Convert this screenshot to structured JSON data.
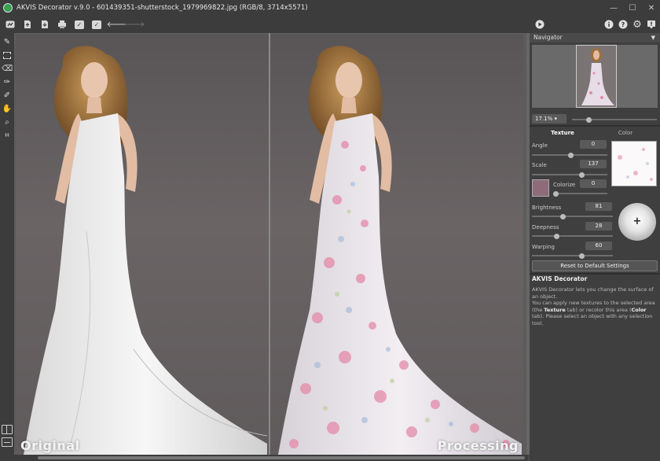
{
  "window": {
    "title": "AKVIS Decorator v.9.0 - 601439351-shutterstock_1979969822.jpg (RGB/8, 3714x5571)",
    "minimize_glyph": "—",
    "maximize_glyph": "☐",
    "close_glyph": "✕"
  },
  "toolbar": {
    "left_icons": [
      "home-icon",
      "open-file-icon",
      "save-file-icon",
      "print-icon",
      "batch-icon",
      "preset-icon",
      "undo-icon",
      "redo-icon"
    ],
    "right_icons": [
      "run-icon",
      "info-icon",
      "help-icon",
      "settings-icon",
      "notifications-icon"
    ]
  },
  "left_tools": [
    "selection-brush-icon",
    "rect-selection-icon",
    "eraser-icon",
    "bucket-icon",
    "magic-brush-icon",
    "hand-icon",
    "zoom-icon",
    "crop-icon"
  ],
  "canvas": {
    "left_label": "Original",
    "right_label": "Processing"
  },
  "navigator": {
    "title": "Navigator",
    "zoom": "17.1%"
  },
  "tabs": {
    "texture": "Texture",
    "color": "Color",
    "active": "Texture"
  },
  "params": {
    "angle": {
      "label": "Angle",
      "value": "0"
    },
    "scale": {
      "label": "Scale",
      "value": "137"
    },
    "colorize": {
      "label": "Colorize",
      "value": "0"
    },
    "brightness": {
      "label": "Brightness",
      "value": "81"
    },
    "deepness": {
      "label": "Deepness",
      "value": "28"
    },
    "warping": {
      "label": "Warping",
      "value": "60"
    }
  },
  "colorize_color": "#8f6b7a",
  "reset_label": "Reset to Default Settings",
  "help": {
    "title": "AKVIS Decorator",
    "line1": "AKVIS Decorator lets you change the surface of an object.",
    "line2_a": "You can apply new textures to the selected area (the ",
    "line2_b": "Texture",
    "line2_c": " tab) or recolor this area (",
    "line2_d": "Color",
    "line2_e": " tab). Please select an object with any selection tool."
  }
}
